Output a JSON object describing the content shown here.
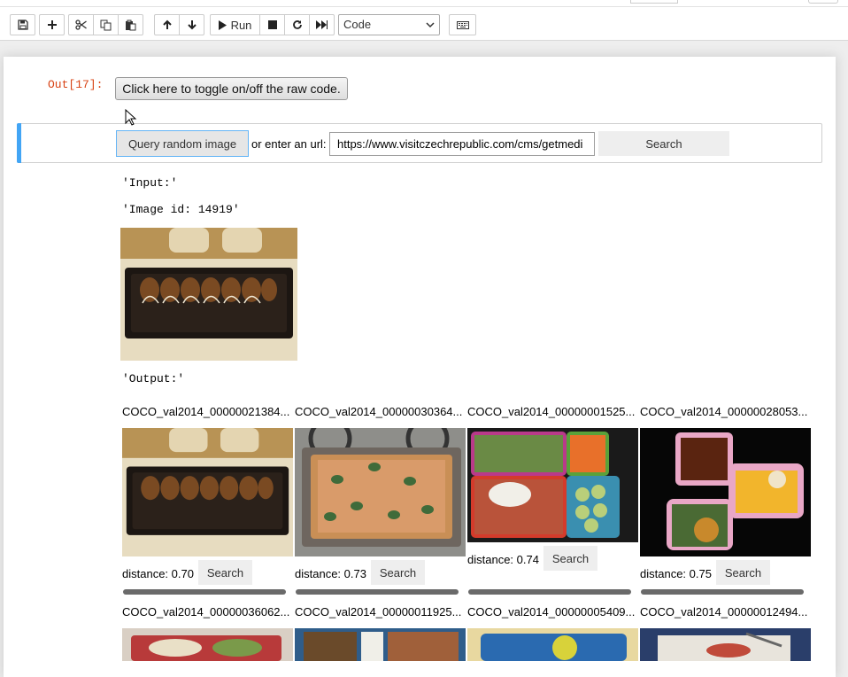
{
  "toolbar": {
    "buttons": [
      {
        "name": "save",
        "icon": "save-icon"
      },
      {
        "name": "insert-cell",
        "icon": "plus-icon"
      },
      {
        "name": "cut",
        "icon": "scissors-icon"
      },
      {
        "name": "copy",
        "icon": "copy-icon"
      },
      {
        "name": "paste",
        "icon": "paste-icon"
      },
      {
        "name": "move-up",
        "icon": "arrow-up-icon"
      },
      {
        "name": "move-down",
        "icon": "arrow-down-icon"
      },
      {
        "name": "run",
        "icon": "play-icon"
      },
      {
        "name": "interrupt",
        "icon": "stop-icon"
      },
      {
        "name": "restart",
        "icon": "refresh-icon"
      },
      {
        "name": "restart-run-all",
        "icon": "fast-forward-icon"
      },
      {
        "name": "command-palette",
        "icon": "keyboard-icon"
      }
    ],
    "run_label": "Run",
    "cell_type": "Code"
  },
  "cell": {
    "prompt": "Out[17]:",
    "toggle_label": "Click here to toggle on/off the raw code."
  },
  "widget": {
    "query_label": "Query random image",
    "or_label": "or enter an url:",
    "url_value": "https://www.visitczechrepublic.com/cms/getmedi",
    "search_label": "Search"
  },
  "output": {
    "input_label": "'Input:'",
    "image_id": "'Image id: 14919'",
    "output_label": "'Output:'"
  },
  "results": [
    {
      "title": "COCO_val2014_00000021384...",
      "distance": "distance: 0.70",
      "search": "Search",
      "image": "dessert-tray"
    },
    {
      "title": "COCO_val2014_00000030364...",
      "distance": "distance: 0.73",
      "search": "Search",
      "image": "pizza-pan"
    },
    {
      "title": "COCO_val2014_00000001525...",
      "distance": "distance: 0.74",
      "search": "Search",
      "image": "bento-box"
    },
    {
      "title": "COCO_val2014_00000028053...",
      "distance": "distance: 0.75",
      "search": "Search",
      "image": "lunch-box"
    }
  ],
  "results_row2": [
    {
      "title": "COCO_val2014_00000036062...",
      "image": "food-plate"
    },
    {
      "title": "COCO_val2014_00000011925...",
      "image": "lunch-tray"
    },
    {
      "title": "COCO_val2014_00000005409...",
      "image": "lunch-container"
    },
    {
      "title": "COCO_val2014_00000012494...",
      "image": "food-board"
    }
  ],
  "colors": {
    "prompt_out": "#d84315",
    "selection_bar": "#42a5f5",
    "query_border": "#64b5f6"
  }
}
